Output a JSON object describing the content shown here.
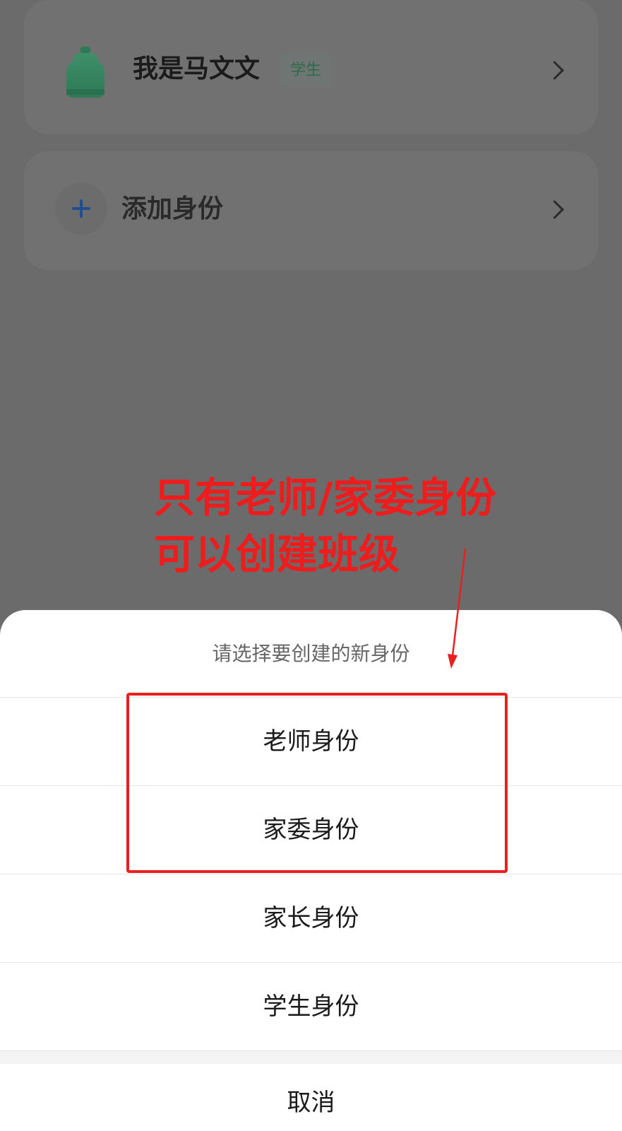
{
  "identity_card": {
    "name": "我是马文文",
    "badge": "学生",
    "avatar_icon": "bottle-avatar-icon",
    "chevron_icon": "chevron-right-icon"
  },
  "add_card": {
    "label": "添加身份",
    "plus_icon": "plus-icon",
    "chevron_icon": "chevron-right-icon"
  },
  "annotation": {
    "lines": [
      "只有老师/家委身份",
      "可以创建班级"
    ],
    "color": "#ee1c1c"
  },
  "sheet": {
    "title": "请选择要创建的新身份",
    "options": [
      {
        "label": "老师身份"
      },
      {
        "label": "家委身份"
      },
      {
        "label": "家长身份"
      },
      {
        "label": "学生身份"
      }
    ],
    "cancel_label": "取消"
  },
  "colors": {
    "overlay": "#6b6b6b",
    "annotation_red": "#ee1c1c",
    "badge_green": "#2f6a4d",
    "plus_blue": "#1f4f8e"
  }
}
